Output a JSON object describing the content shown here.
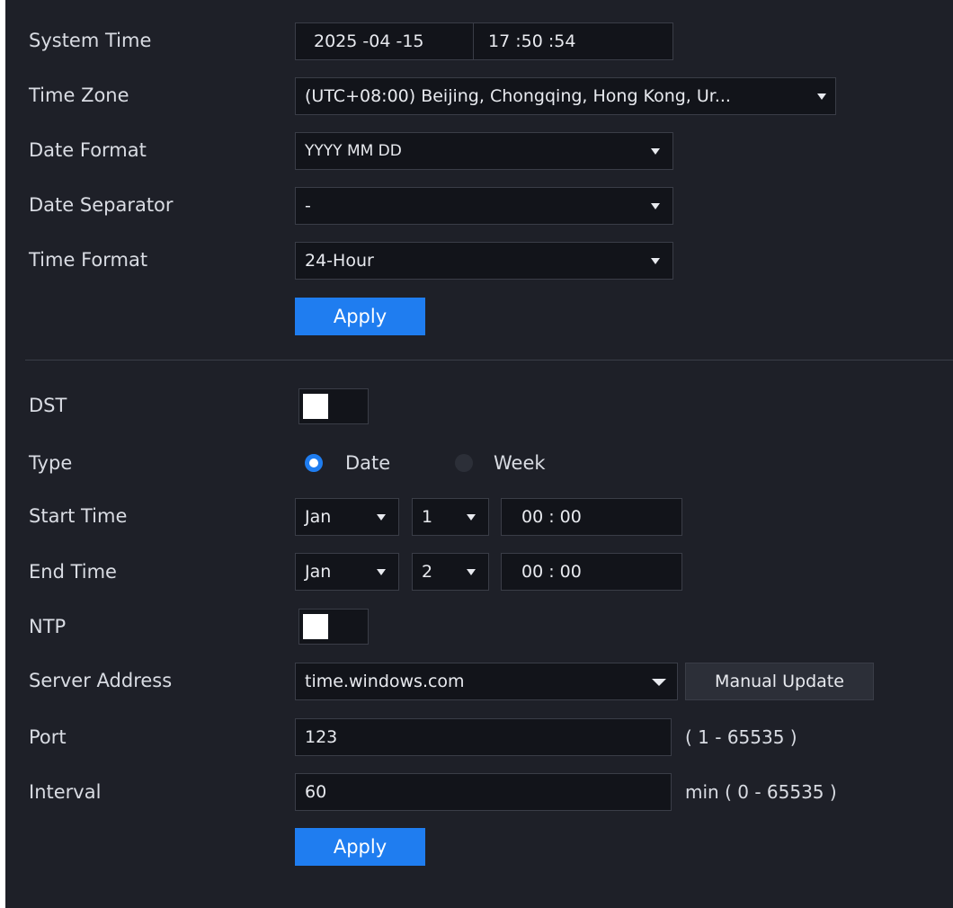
{
  "labels": {
    "system_time": "System Time",
    "time_zone": "Time Zone",
    "date_format": "Date Format",
    "date_separator": "Date Separator",
    "time_format": "Time Format",
    "dst": "DST",
    "type": "Type",
    "start_time": "Start Time",
    "end_time": "End Time",
    "ntp": "NTP",
    "server_address": "Server Address",
    "port": "Port",
    "interval": "Interval"
  },
  "system_time": {
    "date": "2025 -04 -15",
    "time": "17 :50 :54"
  },
  "time_zone": "(UTC+08:00) Beijing, Chongqing, Hong Kong, Ur...",
  "date_format": "YYYY MM DD",
  "date_separator": "-",
  "time_format": "24-Hour",
  "apply_label": "Apply",
  "dst": {
    "enabled": false
  },
  "type": {
    "options": [
      "Date",
      "Week"
    ],
    "selected": "Date"
  },
  "start_time": {
    "month": "Jan",
    "day": "1",
    "time": "00 : 00"
  },
  "end_time": {
    "month": "Jan",
    "day": "2",
    "time": "00 : 00"
  },
  "ntp": {
    "enabled": false
  },
  "server_address": "time.windows.com",
  "manual_update_label": "Manual Update",
  "port": {
    "value": "123",
    "range": "( 1 - 65535 )"
  },
  "interval": {
    "value": "60",
    "range": "min  ( 0 - 65535 )"
  },
  "colors": {
    "background": "#1e2028",
    "accent": "#1f7df0",
    "field": "#12141a"
  }
}
